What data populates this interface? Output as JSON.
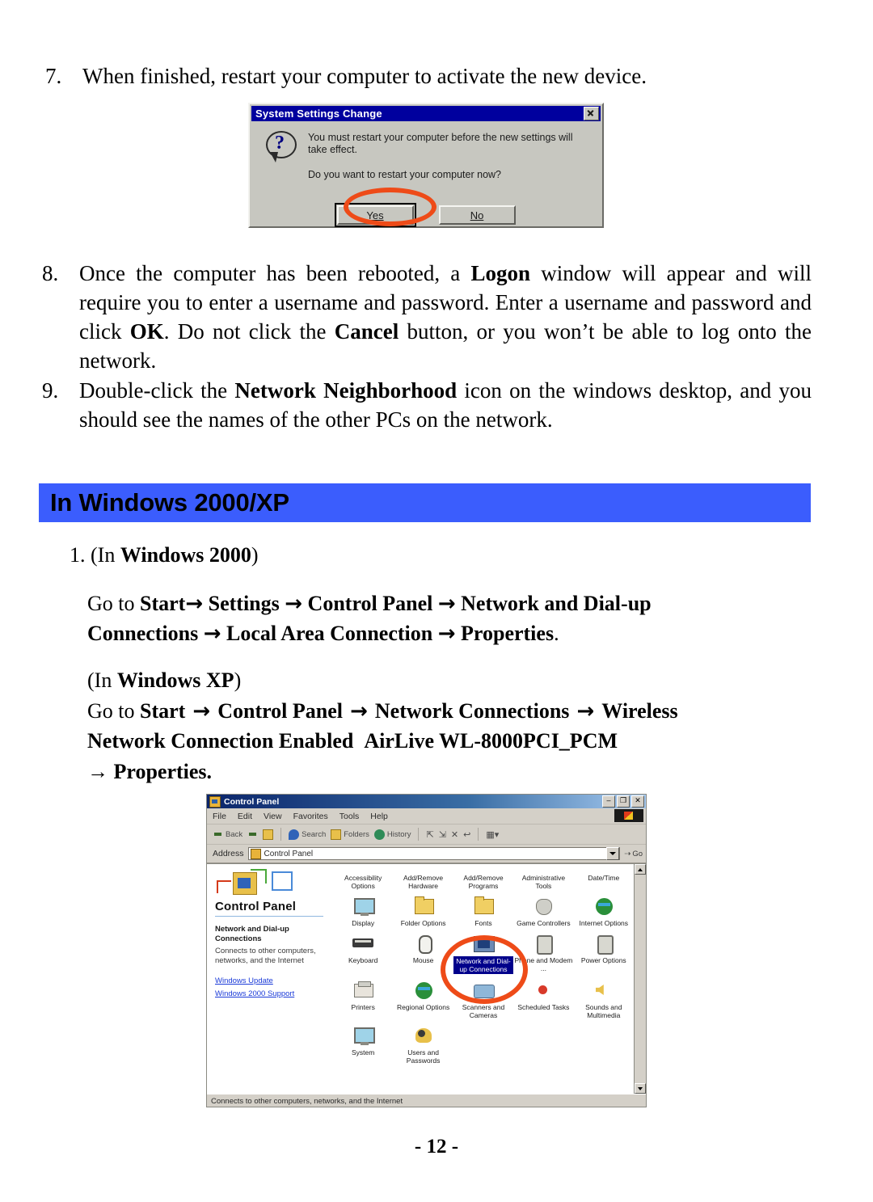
{
  "steps": [
    {
      "num": "7.",
      "html": "When finished, restart your computer to activate the new device."
    }
  ],
  "step7": {
    "num": "7.",
    "text": "When finished, restart your computer to activate the new device."
  },
  "step8": {
    "num": "8.",
    "text_parts": [
      "Once the computer has been rebooted, a ",
      "Logon",
      " window will appear and will require you to enter a username and password. Enter a username and password and click ",
      "OK",
      ".  Do not click the ",
      "Cancel",
      " button, or you won’t be able to log onto the network."
    ]
  },
  "step9": {
    "num": "9.",
    "text_parts": [
      "Double-click the ",
      "Network Neighborhood",
      " icon on the windows desktop, and you should see the names of the other PCs on the network."
    ]
  },
  "dialog": {
    "title": "System Settings Change",
    "close_icon": "close-icon",
    "question_icon": "question-mark-icon",
    "message_line1": "You must restart your computer before the new settings will take effect.",
    "message_line2": "Do you want to restart your computer now?",
    "buttons": [
      {
        "label": "Yes",
        "accel": "Y",
        "default": true
      },
      {
        "label": "No",
        "accel": "N",
        "default": false
      }
    ],
    "annotation_color": "#ee4b18"
  },
  "section": {
    "heading": "In Windows 2000/XP",
    "bar_color": "#3b5dfd"
  },
  "win2000": {
    "num": "1.",
    "label_prefix": "(In ",
    "label_bold": "Windows 2000",
    "label_suffix": ")",
    "path_line1_parts": [
      "Go  to  ",
      "Start",
      "→",
      "  Settings  ",
      "→",
      "  Control  Panel  ",
      "→",
      "  Network  and  Dial-up"
    ],
    "path_line2_parts": [
      "Connections ",
      "→",
      " Local Area Connection ",
      "→",
      " Properties",
      "."
    ]
  },
  "winxp": {
    "label_prefix": "(In ",
    "label_bold": "Windows XP",
    "label_suffix": ")",
    "path_line1_parts": [
      "Go  to  ",
      "Start",
      "  →  ",
      "Control  Panel",
      "  →  ",
      "Network  Connections",
      "  →  ",
      "Wireless"
    ],
    "path_line2_bold": "Network  Connection  Enabled",
    "path_line2_plain": "AirLive WL-8000PCI_PCM",
    "path_line3": "→ Properties."
  },
  "control_panel": {
    "window_title": "Control Panel",
    "window_icon": "control-panel-icon",
    "window_buttons": [
      {
        "name": "minimize-button",
        "glyph": "–"
      },
      {
        "name": "maximize-button",
        "glyph": "❐"
      },
      {
        "name": "close-button",
        "glyph": "✕"
      }
    ],
    "menu": [
      "File",
      "Edit",
      "View",
      "Favorites",
      "Tools",
      "Help"
    ],
    "toolbar": [
      {
        "label": "Back",
        "icon": "back-arrow-icon"
      },
      {
        "label": "",
        "icon": "forward-arrow-icon"
      },
      {
        "label": "",
        "icon": "up-folder-icon"
      },
      {
        "label": "Search",
        "icon": "search-icon"
      },
      {
        "label": "Folders",
        "icon": "folders-icon"
      },
      {
        "label": "History",
        "icon": "history-icon"
      },
      {
        "label": "",
        "icon": "move-to-icon"
      },
      {
        "label": "",
        "icon": "copy-to-icon"
      },
      {
        "label": "",
        "icon": "delete-icon"
      },
      {
        "label": "",
        "icon": "undo-icon"
      },
      {
        "label": "",
        "icon": "views-icon"
      }
    ],
    "address_label": "Address",
    "address_value": "Control Panel",
    "go_label": "Go",
    "sidebar": {
      "heading": "Control Panel",
      "selected_title": "Network and Dial-up Connections",
      "selected_desc": "Connects to other computers, networks, and the Internet",
      "links": [
        "Windows Update",
        "Windows 2000 Support"
      ]
    },
    "items": [
      {
        "label": "Accessibility Options",
        "icon": "accessibility-icon",
        "art": "gl-people",
        "selected": false,
        "clipped": true
      },
      {
        "label": "Add/Remove Hardware",
        "icon": "add-remove-hardware-icon",
        "art": "gl-folder",
        "selected": false,
        "clipped": true
      },
      {
        "label": "Add/Remove Programs",
        "icon": "add-remove-programs-icon",
        "art": "gl-folder",
        "selected": false,
        "clipped": true
      },
      {
        "label": "Administrative Tools",
        "icon": "administrative-tools-icon",
        "art": "gl-folder",
        "selected": false,
        "clipped": true
      },
      {
        "label": "Date/Time",
        "icon": "date-time-icon",
        "art": "gl-globe",
        "selected": false,
        "clipped": true
      },
      {
        "label": "Display",
        "icon": "display-icon",
        "art": "gl-mon",
        "selected": false,
        "clipped": false
      },
      {
        "label": "Folder Options",
        "icon": "folder-options-icon",
        "art": "gl-folder",
        "selected": false,
        "clipped": false
      },
      {
        "label": "Fonts",
        "icon": "fonts-icon",
        "art": "gl-folder",
        "selected": false,
        "clipped": false
      },
      {
        "label": "Game Controllers",
        "icon": "game-controllers-icon",
        "art": "gl-game",
        "selected": false,
        "clipped": false
      },
      {
        "label": "Internet Options",
        "icon": "internet-options-icon",
        "art": "gl-globe",
        "selected": false,
        "clipped": false
      },
      {
        "label": "Keyboard",
        "icon": "keyboard-icon",
        "art": "gl-key",
        "selected": false,
        "clipped": false
      },
      {
        "label": "Mouse",
        "icon": "mouse-icon",
        "art": "gl-mouse",
        "selected": false,
        "clipped": false
      },
      {
        "label": "Network and Dial-up Connections",
        "icon": "network-dialup-connections-icon",
        "art": "gl-net",
        "selected": true,
        "clipped": false
      },
      {
        "label": "Phone and Modem ...",
        "icon": "phone-modem-icon",
        "art": "gl-plug",
        "selected": false,
        "clipped": false
      },
      {
        "label": "Power Options",
        "icon": "power-options-icon",
        "art": "gl-plug",
        "selected": false,
        "clipped": false
      },
      {
        "label": "Printers",
        "icon": "printers-icon",
        "art": "gl-print",
        "selected": false,
        "clipped": false
      },
      {
        "label": "Regional Options",
        "icon": "regional-options-icon",
        "art": "gl-globe",
        "selected": false,
        "clipped": false
      },
      {
        "label": "Scanners and Cameras",
        "icon": "scanners-cameras-icon",
        "art": "gl-scan",
        "selected": false,
        "clipped": false
      },
      {
        "label": "Scheduled Tasks",
        "icon": "scheduled-tasks-icon",
        "art": "gl-red",
        "selected": false,
        "clipped": false
      },
      {
        "label": "Sounds and Multimedia",
        "icon": "sounds-multimedia-icon",
        "art": "gl-spk",
        "selected": false,
        "clipped": false
      },
      {
        "label": "System",
        "icon": "system-icon",
        "art": "gl-mon",
        "selected": false,
        "clipped": false
      },
      {
        "label": "Users and Passwords",
        "icon": "users-passwords-icon",
        "art": "gl-people",
        "selected": false,
        "clipped": false
      }
    ],
    "status_text": "Connects to other computers, networks, and the Internet",
    "annotation_color": "#ee4b18"
  },
  "footer": {
    "page_number": "- 12 -"
  }
}
